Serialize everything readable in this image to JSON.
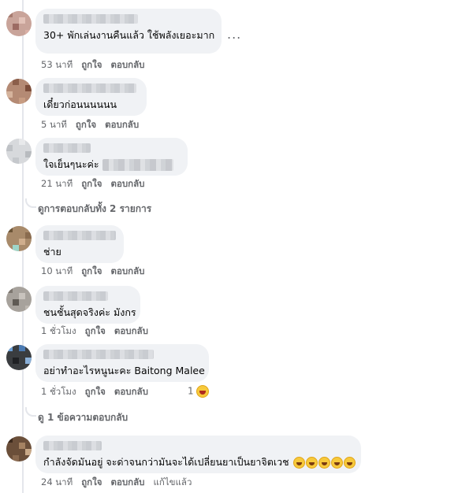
{
  "comments": [
    {
      "text": "30+ พักเล่นงานคืนแล้ว ใช้พลังเยอะมาก",
      "time": "53 นาที",
      "like": "ถูกใจ",
      "reply": "ตอบกลับ",
      "more": "..."
    },
    {
      "text": "เดี๋ยวก่อนนนนนน",
      "time": "5 นาที",
      "like": "ถูกใจ",
      "reply": "ตอบกลับ"
    },
    {
      "text": "ใจเย็นๆนะค่ะ",
      "time": "21 นาที",
      "like": "ถูกใจ",
      "reply": "ตอบกลับ"
    },
    {
      "text": "ช่าย",
      "time": "10 นาที",
      "like": "ถูกใจ",
      "reply": "ตอบกลับ"
    },
    {
      "text": "ชนชั้นสุดจริงค่ะ มังกร",
      "time": "1 ชั่วโมง",
      "like": "ถูกใจ",
      "reply": "ตอบกลับ"
    },
    {
      "text": "อย่าทำอะไรหนูนะคะ Baitong Malee",
      "time": "1 ชั่วโมง",
      "like": "ถูกใจ",
      "reply": "ตอบกลับ",
      "reaction_count": "1"
    },
    {
      "text": "กำลังจัดมันอยู่ จะด่าจนกว่ามันจะได้เปลี่ยนยาเป็นยาจิตเวช",
      "time": "24 นาที",
      "like": "ถูกใจ",
      "reply": "ตอบกลับ",
      "edited": "แก้ไขแล้ว"
    }
  ],
  "view_replies_1": "ดูการตอบกลับทั้ง 2 รายการ",
  "view_replies_2": "ดู 1 ข้อความตอบกลับ",
  "colors": {
    "bubble": "#f0f2f5",
    "meta": "#65676b",
    "text": "#050505",
    "line": "#e4e6eb"
  },
  "icons": [
    "more-options-icon",
    "laugh-reaction-icon",
    "emoji-icon"
  ]
}
